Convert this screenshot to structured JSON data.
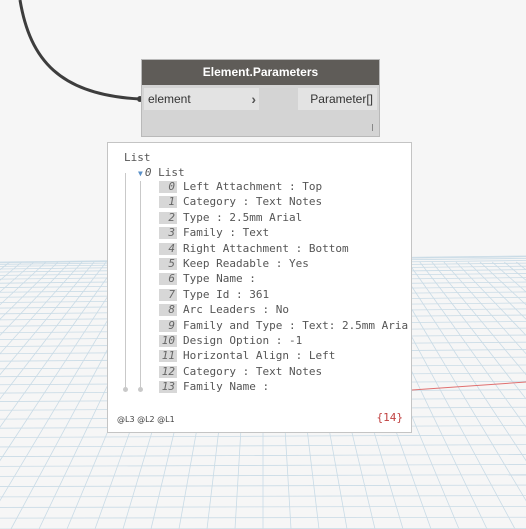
{
  "node": {
    "title": "Element.Parameters",
    "input_port": "element",
    "output_port": "Parameter[]"
  },
  "preview": {
    "root_label": "List",
    "sublist_index": "0",
    "sublist_label": "List",
    "items": [
      {
        "index": "0",
        "text": "Left Attachment : Top"
      },
      {
        "index": "1",
        "text": "Category : Text Notes"
      },
      {
        "index": "2",
        "text": "Type : 2.5mm Arial"
      },
      {
        "index": "3",
        "text": "Family : Text"
      },
      {
        "index": "4",
        "text": "Right Attachment : Bottom"
      },
      {
        "index": "5",
        "text": "Keep Readable : Yes"
      },
      {
        "index": "6",
        "text": "Type Name :"
      },
      {
        "index": "7",
        "text": "Type Id : 361"
      },
      {
        "index": "8",
        "text": "Arc Leaders : No"
      },
      {
        "index": "9",
        "text": "Family and Type : Text: 2.5mm Aria"
      },
      {
        "index": "10",
        "text": "Design Option : -1"
      },
      {
        "index": "11",
        "text": "Horizontal Align : Left"
      },
      {
        "index": "12",
        "text": "Category : Text Notes"
      },
      {
        "index": "13",
        "text": "Family Name :"
      }
    ],
    "levels": "@L3 @L2 @L1",
    "count": "{14}"
  },
  "colors": {
    "node_header": "#5f5c58",
    "wire": "#3d3d3d",
    "grid": "#c9dbe6",
    "count_text": "#c04040"
  }
}
